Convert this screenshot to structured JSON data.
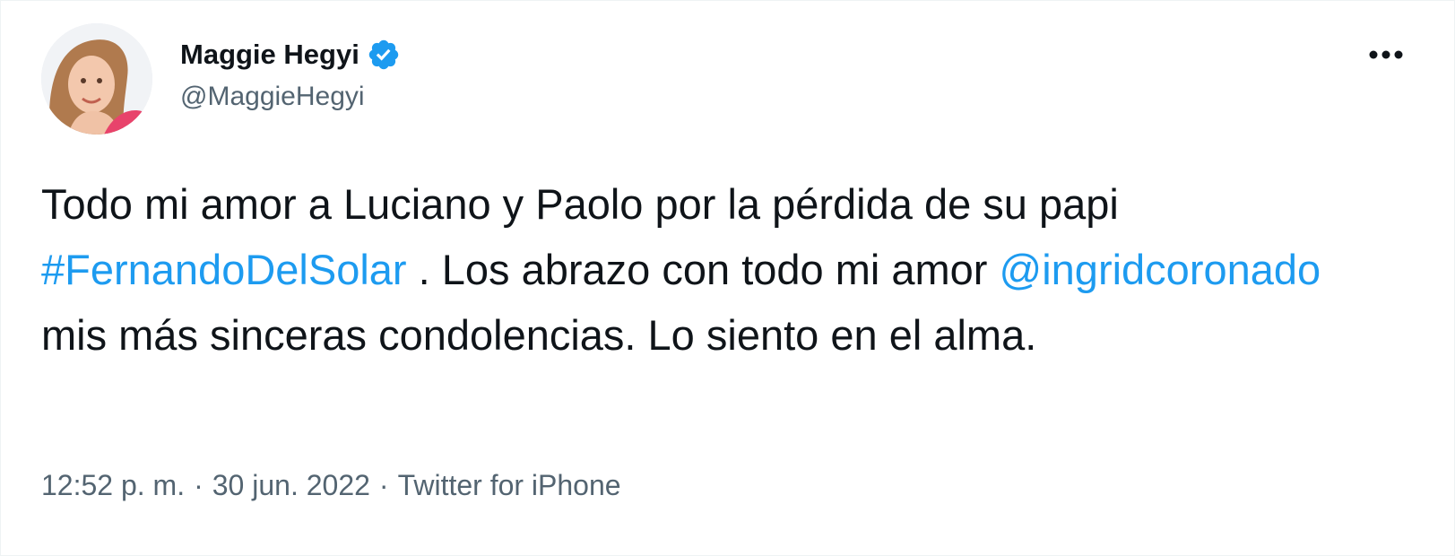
{
  "author": {
    "display_name": "Maggie Hegyi",
    "handle": "@MaggieHegyi",
    "verified": true,
    "verified_icon": "verified-badge-icon",
    "avatar_icon": "profile-photo"
  },
  "more_menu": {
    "icon": "more-horizontal-icon"
  },
  "tweet": {
    "text_part1": "Todo mi amor a Luciano y Paolo por la pérdida de su papi ",
    "hashtag": "#FernandoDelSolar",
    "text_part2": " . Los abrazo con todo mi amor ",
    "mention": "@ingridcoronado",
    "text_part3": " mis más sinceras condolencias. Lo siento en el alma."
  },
  "meta": {
    "time": "12:52 p. m.",
    "separator": "·",
    "date": "30 jun. 2022",
    "source": "Twitter for iPhone"
  },
  "colors": {
    "accent": "#1d9bf0",
    "text": "#0f1419",
    "secondary": "#536471"
  }
}
